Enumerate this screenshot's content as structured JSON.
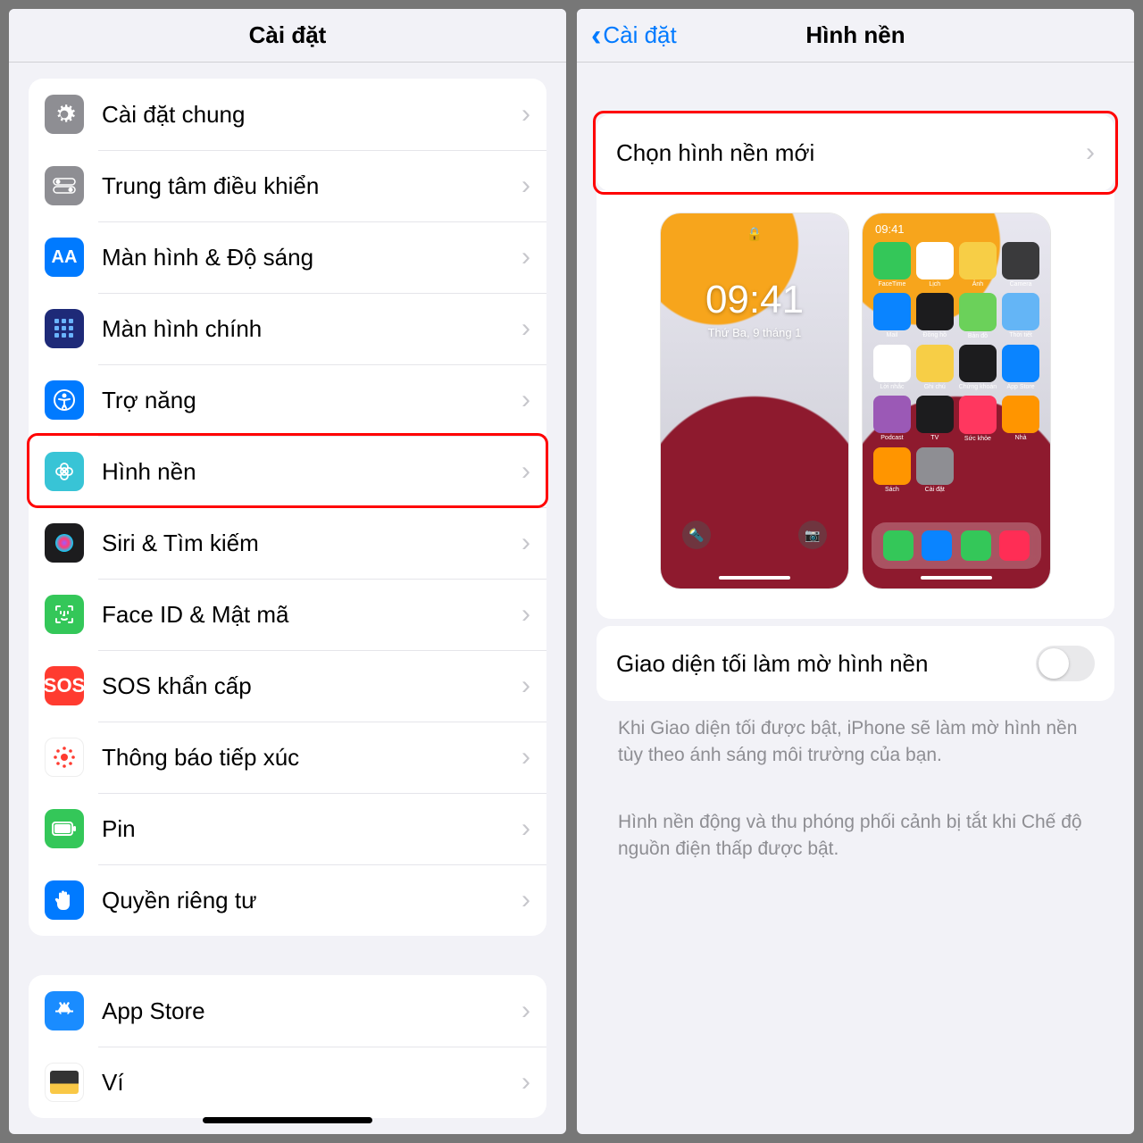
{
  "left": {
    "title": "Cài đặt",
    "rows": [
      {
        "label": "Cài đặt chung"
      },
      {
        "label": "Trung tâm điều khiển"
      },
      {
        "label": "Màn hình & Độ sáng"
      },
      {
        "label": "Màn hình chính"
      },
      {
        "label": "Trợ năng"
      },
      {
        "label": "Hình nền"
      },
      {
        "label": "Siri & Tìm kiếm"
      },
      {
        "label": "Face ID & Mật mã"
      },
      {
        "label": "SOS khẩn cấp"
      },
      {
        "label": "Thông báo tiếp xúc"
      },
      {
        "label": "Pin"
      },
      {
        "label": "Quyền riêng tư"
      }
    ],
    "block2": [
      {
        "label": "App Store"
      },
      {
        "label": "Ví"
      }
    ]
  },
  "right": {
    "back": "Cài đặt",
    "title": "Hình nền",
    "choose": "Chọn hình nền mới",
    "lock": {
      "time": "09:41",
      "date": "Thứ Ba, 9 tháng 1"
    },
    "home": {
      "time": "09:41",
      "apps": [
        "FaceTime",
        "Lịch",
        "Ảnh",
        "Camera",
        "Mail",
        "Đồng hồ",
        "Bản đồ",
        "Thời tiết",
        "Lời nhắc",
        "Ghi chú",
        "Chứng khoán",
        "App Store",
        "Podcast",
        "TV",
        "Sức khỏe",
        "Nhà",
        "Sách",
        "Cài đặt"
      ]
    },
    "dimLabel": "Giao diện tối làm mờ hình nền",
    "note1": "Khi Giao diện tối được bật, iPhone sẽ làm mờ hình nền tùy theo ánh sáng môi trường của bạn.",
    "note2": "Hình nền động và thu phóng phối cảnh bị tắt khi Chế độ nguồn điện thấp được bật."
  },
  "sos": "SOS"
}
